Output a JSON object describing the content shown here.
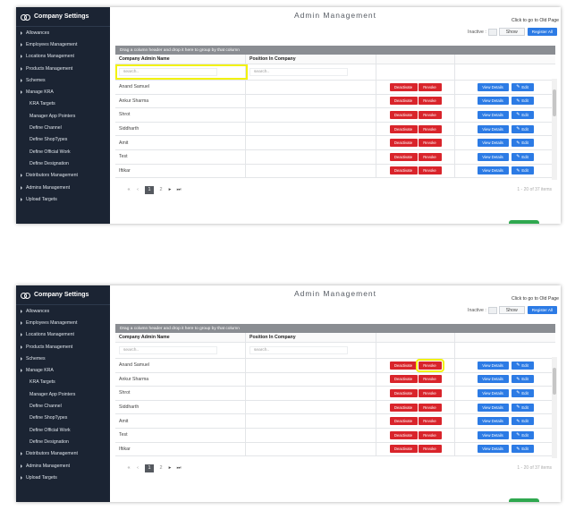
{
  "app_title": "Company Settings",
  "page_title": "Admin Management",
  "old_page_link": "Click to go to Old Page",
  "inactive_label": "Inactive :",
  "show_label": "Show",
  "register_label": "Register All",
  "sidebar": {
    "items": [
      {
        "label": "Allowances",
        "icon": "caret-right-icon"
      },
      {
        "label": "Employees Management",
        "icon": "caret-right-icon"
      },
      {
        "label": "Locations Management",
        "icon": "caret-right-icon"
      },
      {
        "label": "Products Management",
        "icon": "caret-right-icon"
      },
      {
        "label": "Schemes",
        "icon": "caret-right-icon"
      },
      {
        "label": "Manage KRA",
        "icon": "caret-right-icon"
      },
      {
        "label": "KRA Targets",
        "icon": ""
      },
      {
        "label": "Manager App Pointers",
        "icon": ""
      },
      {
        "label": "Define Channel",
        "icon": ""
      },
      {
        "label": "Define ShopTypes",
        "icon": ""
      },
      {
        "label": "Define Official Work",
        "icon": ""
      },
      {
        "label": "Define Designation",
        "icon": ""
      },
      {
        "label": "Distributors Management",
        "icon": "caret-right-icon"
      },
      {
        "label": "Admins Management",
        "icon": "caret-right-icon"
      },
      {
        "label": "Upload Targets",
        "icon": "caret-right-icon"
      }
    ]
  },
  "grid": {
    "group_hint": "Drag a column header and drop it here to group by that column",
    "columns": [
      "Company Admin Name",
      "Position In Company",
      "",
      ""
    ],
    "search_placeholder": "search..",
    "rows": [
      {
        "name": "Anand Samuel",
        "position": ""
      },
      {
        "name": "Ankur Sharma",
        "position": ""
      },
      {
        "name": "Shrot",
        "position": ""
      },
      {
        "name": "Siddharth",
        "position": ""
      },
      {
        "name": "Amit",
        "position": ""
      },
      {
        "name": "Test",
        "position": ""
      },
      {
        "name": "Iftikar",
        "position": ""
      }
    ],
    "deactivate_label": "Deactivate",
    "revoke_label": "Revoke",
    "view_details_label": "View Details",
    "edit_label": "Edit"
  },
  "pager": {
    "first": "«",
    "prev": "‹",
    "pages": [
      "1",
      "2"
    ],
    "current_page": "1",
    "next": "▸",
    "last": "⏭",
    "summary": "1 - 20 of 37 items"
  },
  "colors": {
    "sidebar_bg": "#1b2433",
    "highlight": "#f2f20a",
    "danger": "#d9242b",
    "primary": "#2c7be5"
  }
}
